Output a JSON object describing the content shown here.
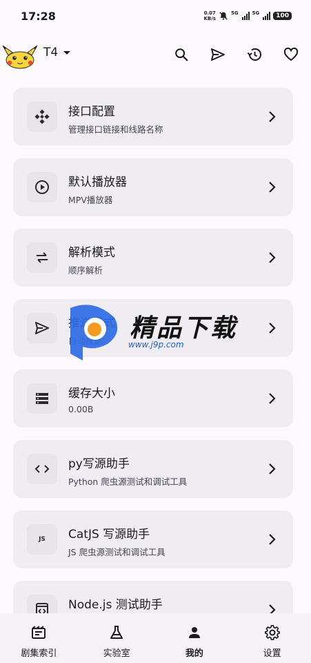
{
  "status_bar": {
    "time": "17:28",
    "net_speed_value": "0.07",
    "net_speed_unit": "KB/s",
    "sim1_type": "5G",
    "sim2_type": "5G",
    "battery": "100"
  },
  "header": {
    "site_name": "T4",
    "icons": [
      "search-icon",
      "send-icon",
      "history-icon",
      "heart-icon"
    ]
  },
  "cards": [
    {
      "title": "接口配置",
      "subtitle": "管理接口链接和线路名称",
      "icon": "settings-nodes-icon"
    },
    {
      "title": "默认播放器",
      "subtitle": "MPV播放器",
      "icon": "play-circle-icon"
    },
    {
      "title": "解析模式",
      "subtitle": "顺序解析",
      "icon": "swap-arrows-icon"
    },
    {
      "title": "推送模式",
      "subtitle": "自动推送",
      "icon": "send-icon"
    },
    {
      "title": "缓存大小",
      "subtitle": "0.00B",
      "icon": "storage-icon"
    },
    {
      "title": "py写源助手",
      "subtitle": "Python 爬虫源测试和调试工具",
      "icon": "code-icon"
    },
    {
      "title": "CatJS 写源助手",
      "subtitle": "JS 爬虫源测试和调试工具",
      "icon": "js-icon",
      "icon_text": "JS"
    },
    {
      "title": "Node.js 测试助手",
      "subtitle": "",
      "icon": "code-file-icon"
    }
  ],
  "bottom_nav": [
    {
      "label": "剧集索引",
      "icon": "video-list-icon"
    },
    {
      "label": "实验室",
      "icon": "flask-icon"
    },
    {
      "label": "我的",
      "icon": "person-icon",
      "active": true
    },
    {
      "label": "设置",
      "icon": "gear-icon"
    }
  ],
  "watermark": {
    "name": "精品下载",
    "url": "www.j9p.com"
  },
  "colors": {
    "background": "#fbf9fc",
    "card": "#efedf1",
    "icon_tile": "#e7e5ea",
    "nav_bar": "#f4f2f6",
    "watermark_blue": "#1f5fe0",
    "watermark_orange": "#f59a1c"
  }
}
